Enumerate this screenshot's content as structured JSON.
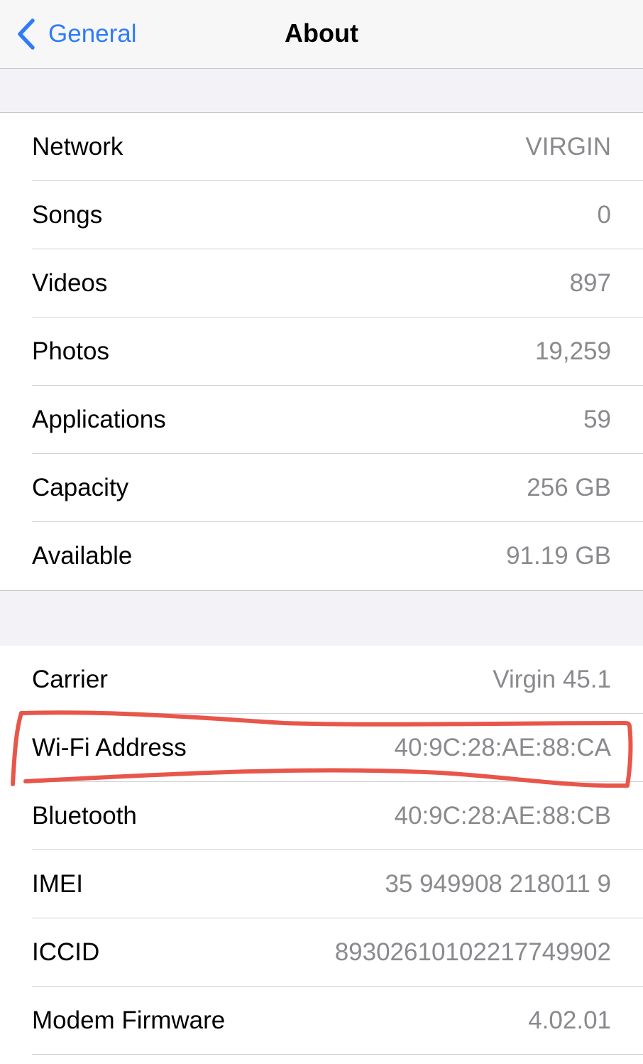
{
  "navbar": {
    "back_label": "General",
    "title": "About",
    "back_icon": "chevron-left-icon",
    "accent_color": "#2f7cf6"
  },
  "section1": {
    "rows": [
      {
        "label": "Network",
        "value": "VIRGIN"
      },
      {
        "label": "Songs",
        "value": "0"
      },
      {
        "label": "Videos",
        "value": "897"
      },
      {
        "label": "Photos",
        "value": "19,259"
      },
      {
        "label": "Applications",
        "value": "59"
      },
      {
        "label": "Capacity",
        "value": "256 GB"
      },
      {
        "label": "Available",
        "value": "91.19 GB"
      }
    ]
  },
  "section2": {
    "rows": [
      {
        "label": "Carrier",
        "value": "Virgin 45.1"
      },
      {
        "label": "Wi-Fi Address",
        "value": "40:9C:28:AE:88:CA"
      },
      {
        "label": "Bluetooth",
        "value": "40:9C:28:AE:88:CB"
      },
      {
        "label": "IMEI",
        "value": "35 949908 218011 9"
      },
      {
        "label": "ICCID",
        "value": "8930261010221774990​2"
      },
      {
        "label": "Modem Firmware",
        "value": "4.02.01"
      }
    ]
  },
  "annotation": {
    "highlighted_row": "Wi-Fi Address",
    "color": "#e8564a"
  }
}
